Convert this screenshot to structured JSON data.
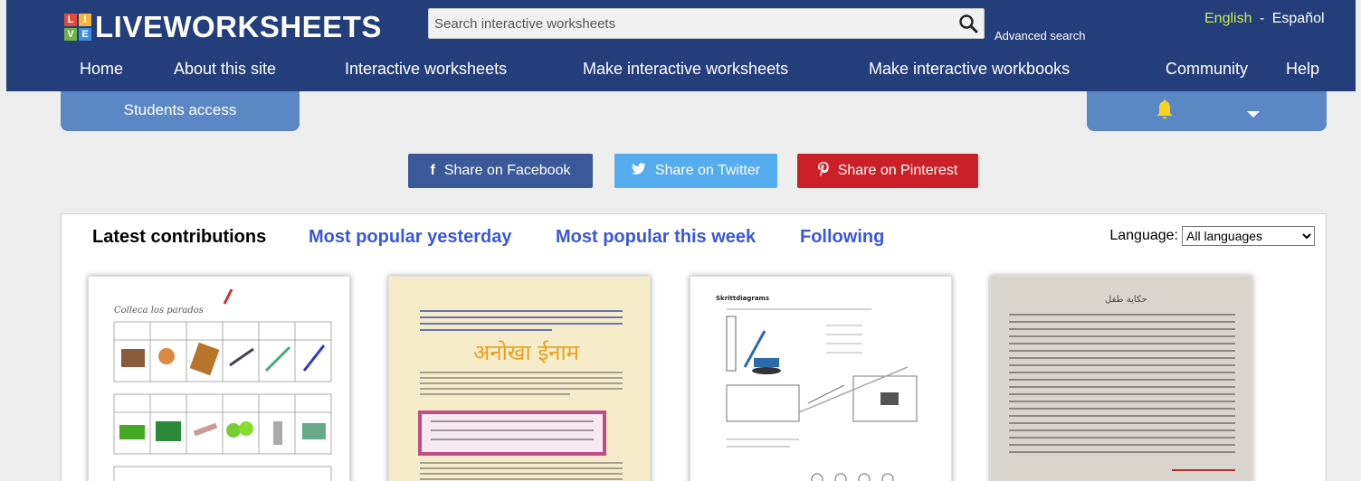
{
  "header": {
    "logo_text": "LIVEWORKSHEETS",
    "logo_grid_letters": [
      "L",
      "I",
      "V",
      "E"
    ],
    "search": {
      "placeholder": "Search interactive worksheets"
    },
    "advanced_search": "Advanced search",
    "languages": {
      "english": "English",
      "separator": "-",
      "spanish": "Español"
    },
    "colors": {
      "bar": "#233e7a",
      "active_language": "#c9ea55"
    }
  },
  "nav": {
    "items": [
      {
        "label": "Home"
      },
      {
        "label": "About this site"
      },
      {
        "label": "Interactive worksheets"
      },
      {
        "label": "Make interactive worksheets"
      },
      {
        "label": "Make interactive workbooks"
      },
      {
        "label": "Community"
      },
      {
        "label": "Help"
      }
    ]
  },
  "subbar": {
    "students_access": "Students access",
    "bell_icon": "bell-icon",
    "dropdown_icon": "caret-down-icon"
  },
  "share": {
    "facebook": {
      "label": "Share on Facebook",
      "icon": "f",
      "color": "#3b5998"
    },
    "twitter": {
      "label": "Share on Twitter",
      "icon": "twitter-bird-icon",
      "color": "#55acee"
    },
    "pinterest": {
      "label": "Share on Pinterest",
      "icon": "pinterest-icon",
      "color": "#cb2027"
    }
  },
  "contributions": {
    "tabs": [
      {
        "label": "Latest contributions",
        "active": true
      },
      {
        "label": "Most popular yesterday",
        "active": false
      },
      {
        "label": "Most popular this week",
        "active": false
      },
      {
        "label": "Following",
        "active": false
      }
    ],
    "language_label": "Language:",
    "language_selected": "All languages",
    "worksheets": [
      {
        "title_text": "Colleca los parados",
        "thumbnail": "french-vocabulary-worksheet-thumbnail"
      },
      {
        "title_text": "अनोखा ईनाम",
        "thumbnail": "hindi-story-worksheet-thumbnail"
      },
      {
        "title_text": "Skrittdiagrams",
        "thumbnail": "physics-diagrams-worksheet-thumbnail"
      },
      {
        "title_text": "حكاية طفل",
        "thumbnail": "arabic-text-worksheet-thumbnail"
      }
    ]
  }
}
